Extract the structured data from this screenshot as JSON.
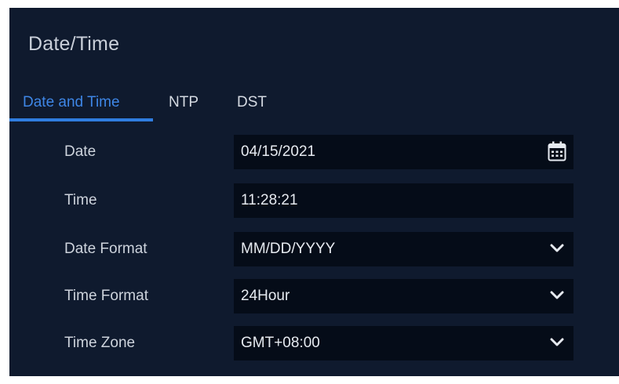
{
  "window": {
    "title": "Date/Time"
  },
  "tabs": [
    {
      "label": "Date and Time",
      "active": true
    },
    {
      "label": "NTP",
      "active": false
    },
    {
      "label": "DST",
      "active": false
    }
  ],
  "fields": {
    "date": {
      "label": "Date",
      "value": "04/15/2021",
      "icon": "calendar-icon"
    },
    "time": {
      "label": "Time",
      "value": "11:28:21"
    },
    "date_format": {
      "label": "Date Format",
      "value": "MM/DD/YYYY",
      "icon": "chevron-down-icon"
    },
    "time_format": {
      "label": "Time Format",
      "value": "24Hour",
      "icon": "chevron-down-icon"
    },
    "time_zone": {
      "label": "Time Zone",
      "value": "GMT+08:00",
      "icon": "chevron-down-icon"
    }
  },
  "colors": {
    "background": "#0f1a2e",
    "field_background": "#050c18",
    "accent": "#2f7de0",
    "text": "#cdd3dc"
  }
}
